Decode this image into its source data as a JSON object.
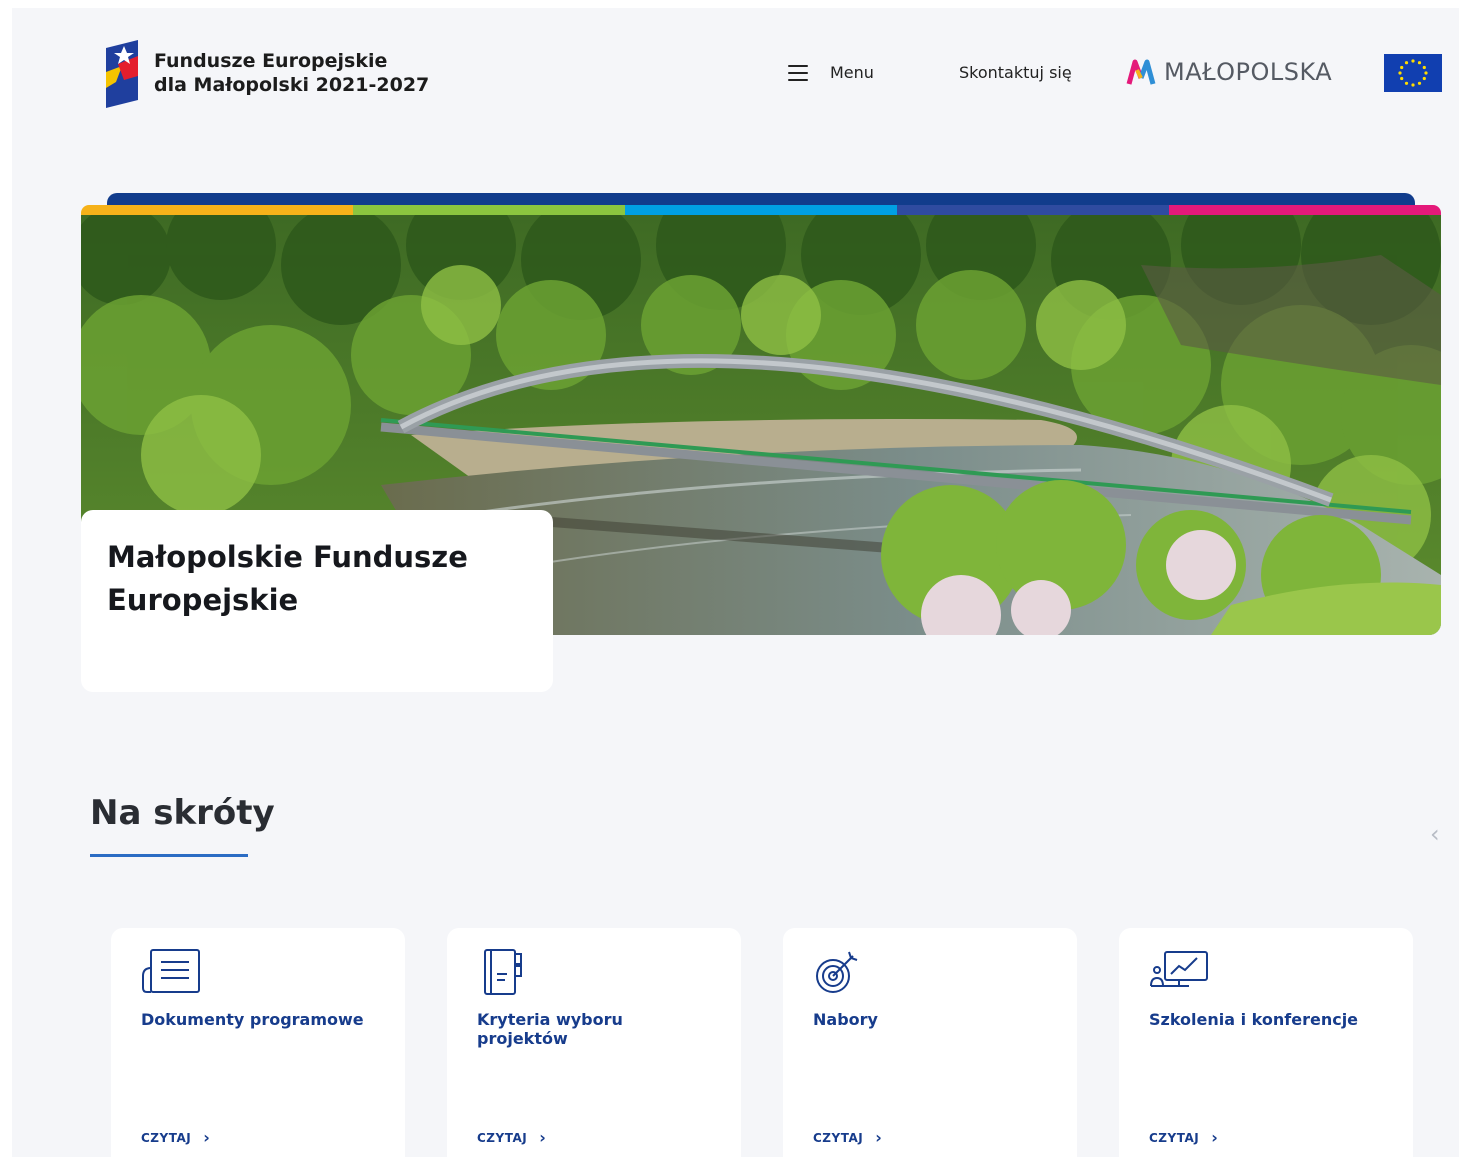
{
  "header": {
    "logo_line1": "Fundusze Europejskie",
    "logo_line2": "dla Małopolski 2021-2027",
    "menu_label": "Menu",
    "contact_label": "Skontaktuj się",
    "region_label": "MAŁOPOLSKA"
  },
  "hero": {
    "title": "Małopolskie Fundusze Europejskie",
    "stripe_colors": [
      "#f6b21a",
      "#8bc53f",
      "#00a0e3",
      "#2f4ba0",
      "#e4197a"
    ],
    "topbar_color": "#113c8c"
  },
  "shortcuts": {
    "title": "Na skróty",
    "prev_icon": "chevron-left-icon",
    "items": [
      {
        "label": "Dokumenty programowe",
        "icon": "document-icon",
        "link": "CZYTAJ"
      },
      {
        "label": "Kryteria wyboru projektów",
        "icon": "notebook-icon",
        "link": "CZYTAJ"
      },
      {
        "label": "Nabory",
        "icon": "target-icon",
        "link": "CZYTAJ"
      },
      {
        "label": "Szkolenia i konferencje",
        "icon": "presentation-icon",
        "link": "CZYTAJ"
      }
    ]
  },
  "colors": {
    "accent": "#173c8c",
    "underline": "#2b6cc4",
    "eu_blue": "#113fb0",
    "eu_star": "#ffdd00"
  }
}
